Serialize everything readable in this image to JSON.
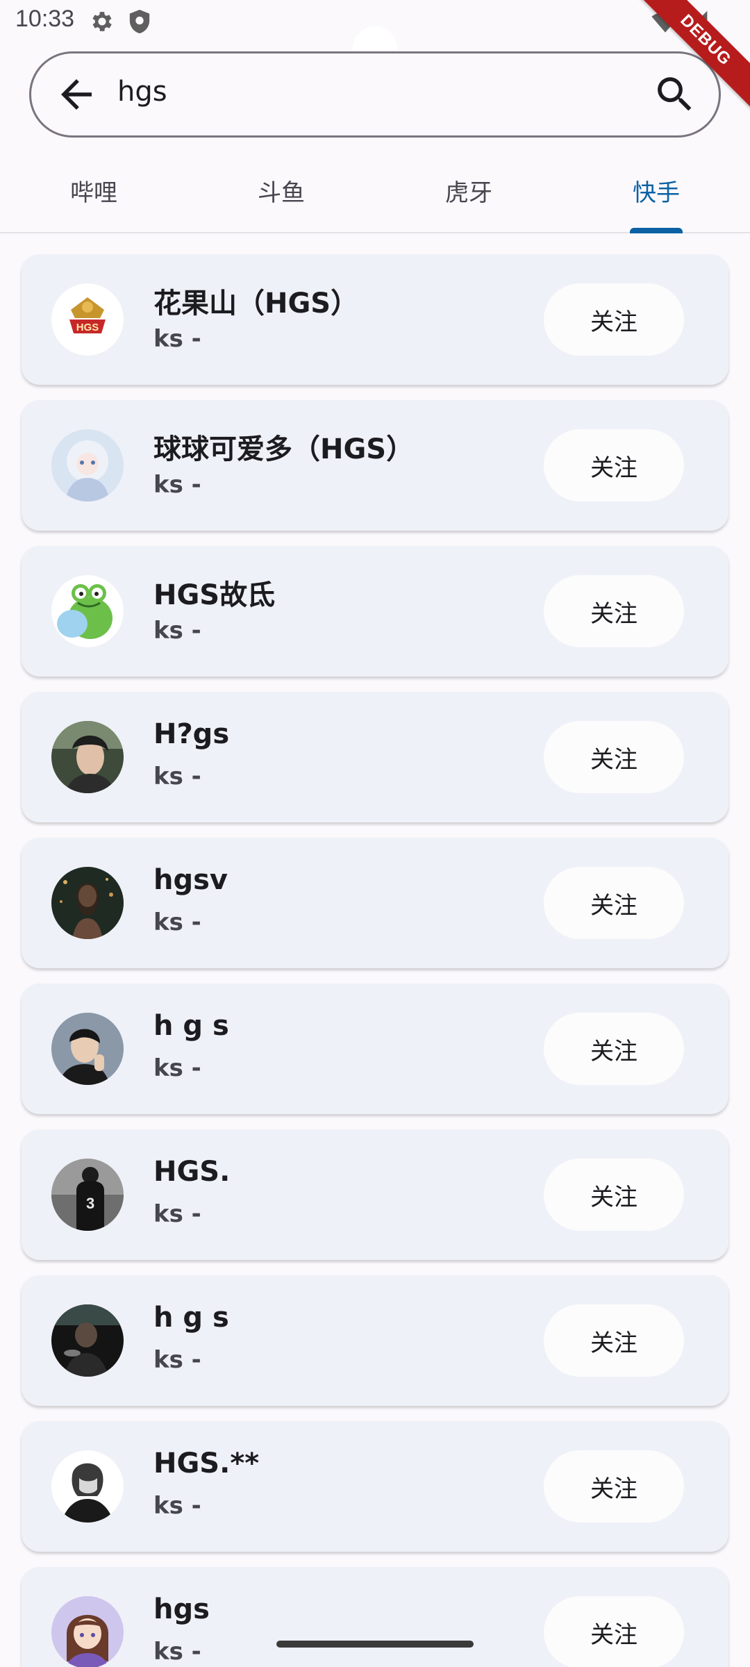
{
  "status_bar": {
    "time": "10:33",
    "left_icons": [
      "settings-icon",
      "shield-icon"
    ],
    "right_icons": [
      "wifi-alert-icon",
      "signal-icon"
    ]
  },
  "debug_banner": "DEBUG",
  "search": {
    "query": "hgs"
  },
  "tabs": [
    {
      "label": "哔哩",
      "active": false
    },
    {
      "label": "斗鱼",
      "active": false
    },
    {
      "label": "虎牙",
      "active": false
    },
    {
      "label": "快手",
      "active": true
    }
  ],
  "results": [
    {
      "name": "花果山（HGS）",
      "subtitle": "ks -",
      "follow_label": "关注",
      "avatar": "hgs-logo"
    },
    {
      "name": "球球可爱多（HGS）",
      "subtitle": "ks -",
      "follow_label": "关注",
      "avatar": "anime-girl-light"
    },
    {
      "name": "HGS故氐",
      "subtitle": "ks -",
      "follow_label": "关注",
      "avatar": "frog-cartoon"
    },
    {
      "name": "H?gs",
      "subtitle": "ks -",
      "follow_label": "关注",
      "avatar": "photo-girl"
    },
    {
      "name": "hgsv",
      "subtitle": "ks -",
      "follow_label": "关注",
      "avatar": "photo-night"
    },
    {
      "name": "h g s",
      "subtitle": "ks -",
      "follow_label": "关注",
      "avatar": "photo-boy"
    },
    {
      "name": "HGS.",
      "subtitle": "ks -",
      "follow_label": "关注",
      "avatar": "photo-bw-jersey"
    },
    {
      "name": "h g s",
      "subtitle": "ks -",
      "follow_label": "关注",
      "avatar": "photo-dark"
    },
    {
      "name": "HGS.**",
      "subtitle": "ks -",
      "follow_label": "关注",
      "avatar": "sketch-boy"
    },
    {
      "name": "hgs",
      "subtitle": "ks -",
      "follow_label": "关注",
      "avatar": "anime-girl-purple"
    }
  ],
  "colors": {
    "accent": "#0b61a4",
    "card_bg": "#eff1f8",
    "page_bg": "#fbf9fc",
    "debug_red": "#b71c1c"
  }
}
